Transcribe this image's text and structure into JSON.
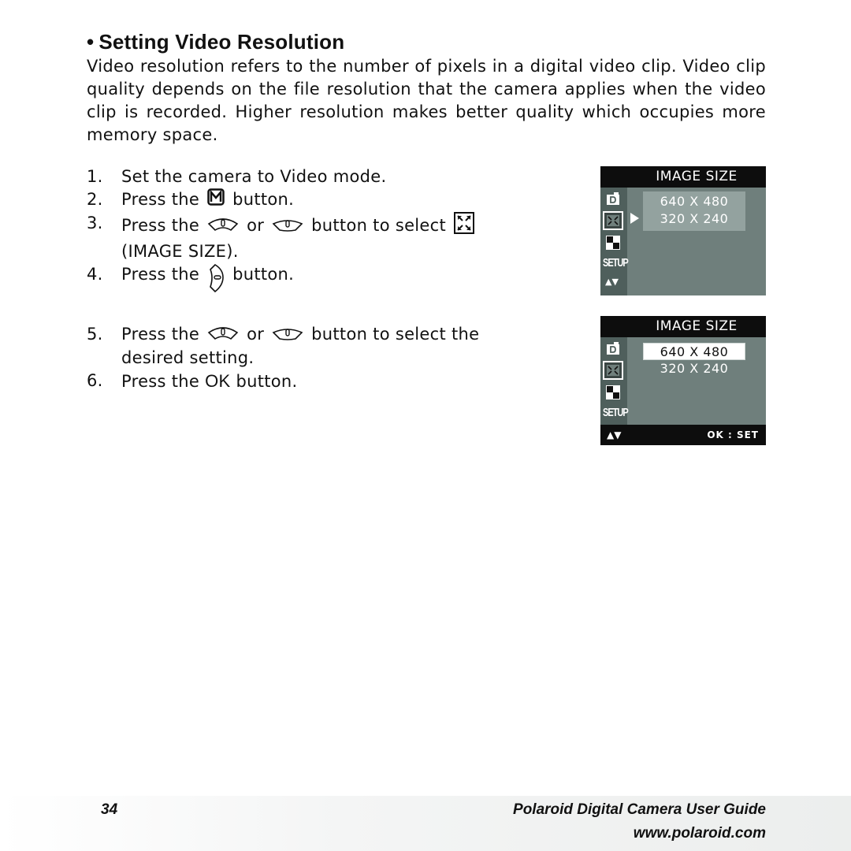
{
  "heading": {
    "bullet": "•",
    "title": "Setting Video Resolution"
  },
  "intro": "Video resolution refers to the number of pixels in a digital video clip. Video clip quality depends on the file resolution that the camera applies when the video clip is recorded. Higher resolution makes better quality which occupies more memory space.",
  "steps": [
    {
      "num": "1.",
      "text": "Set the camera to Video mode."
    },
    {
      "num": "2.",
      "pre": "Press the",
      "icon": "menu-m-button-icon",
      "post": "button."
    },
    {
      "num": "3.",
      "pre": "Press the",
      "mid": "or",
      "post": "button to select",
      "line2": "(IMAGE SIZE)."
    },
    {
      "num": "4.",
      "pre": "Press the",
      "icon": "right-nav-button-icon",
      "post": "button."
    },
    {
      "num": "5.",
      "pre": "Press the",
      "mid": "or",
      "post": "button to select the",
      "line2": "desired setting."
    },
    {
      "num": "6.",
      "pre": "Press the",
      "ok": "OK",
      "post": "button."
    }
  ],
  "screens": [
    {
      "title": "IMAGE SIZE",
      "sidebar": [
        "camera-mode-icon",
        "image-size-icon",
        "quality-icon",
        "setup-icon",
        "up-down-icon"
      ],
      "setup_label": "SETUP",
      "options": [
        "640 X 480",
        "320 X 240"
      ],
      "selected_option": null
    },
    {
      "title": "IMAGE SIZE",
      "sidebar": [
        "camera-mode-icon",
        "image-size-icon",
        "quality-icon",
        "setup-icon"
      ],
      "setup_label": "SETUP",
      "options": [
        "640 X 480",
        "320 X 240"
      ],
      "selected_option": "640 X 480",
      "footer": {
        "nav": "▲▼",
        "ok": "OK :  SET"
      }
    }
  ],
  "footer": {
    "page_number": "34",
    "guide_title": "Polaroid Digital Camera User Guide",
    "url": "www.polaroid.com"
  },
  "colors": {
    "screen_bg": "#6f7f7c",
    "screen_sidebar": "#4f5f5c",
    "options_highlight": "#93a29f",
    "screen_title_bg": "#0d0d0d"
  }
}
